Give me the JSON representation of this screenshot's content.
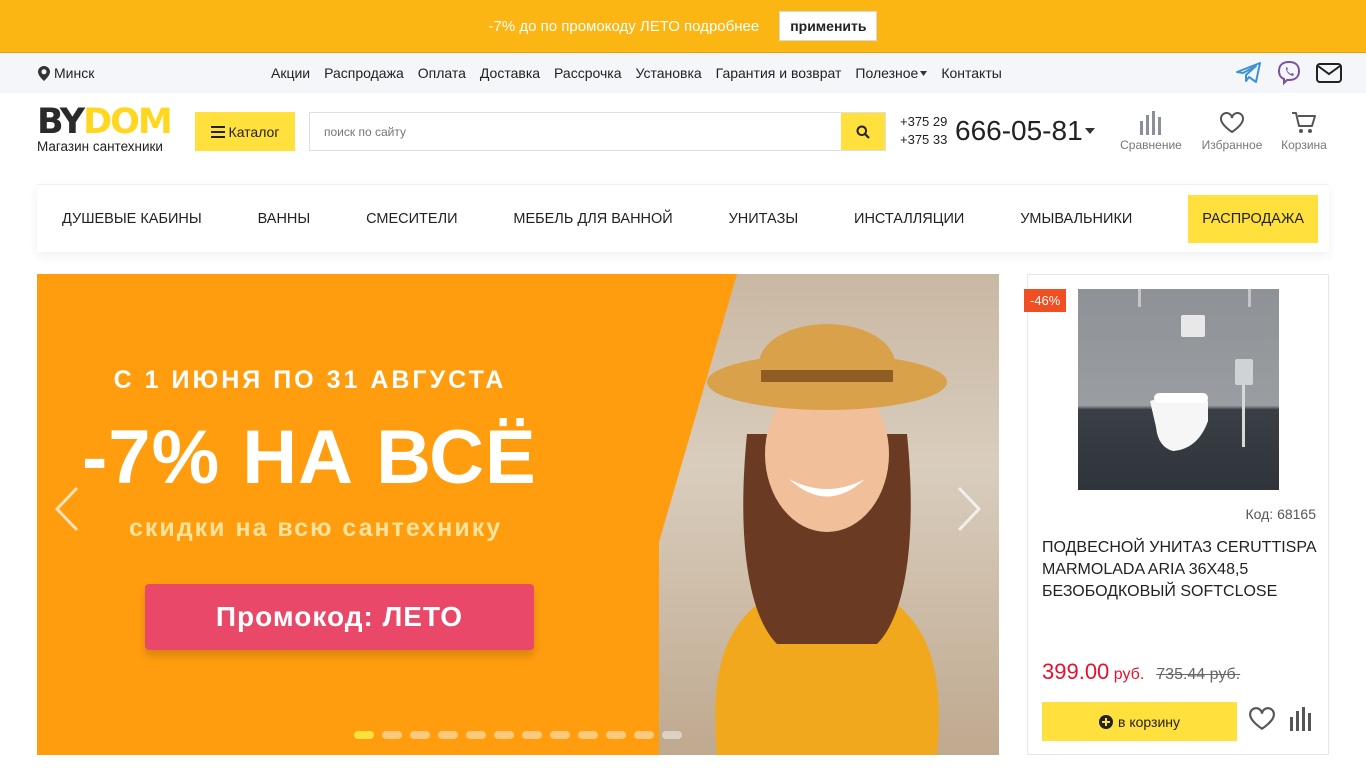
{
  "promo": {
    "text": "-7% до по промокоду ЛЕТО подробнее",
    "button": "применить"
  },
  "topnav": {
    "city": "Минск",
    "links": [
      "Акции",
      "Распродажа",
      "Оплата",
      "Доставка",
      "Рассрочка",
      "Установка",
      "Гарантия и возврат",
      "Полезное",
      "Контакты"
    ],
    "social": [
      "telegram-icon",
      "viber-icon",
      "email-icon"
    ]
  },
  "header": {
    "logo_main_1": "BY",
    "logo_main_2": "DOM",
    "logo_sub": "Магазин сантехники",
    "catalog": "Каталог",
    "search_placeholder": "поиск по сайту",
    "phone_code_1": "+375 29",
    "phone_code_2": "+375 33",
    "phone_number": "666-05-81",
    "compare": "Сравнение",
    "favorites": "Избранное",
    "cart": "Корзина"
  },
  "categories": [
    "ДУШЕВЫЕ КАБИНЫ",
    "ВАННЫ",
    "СМЕСИТЕЛИ",
    "МЕБЕЛЬ ДЛЯ ВАННОЙ",
    "УНИТАЗЫ",
    "ИНСТАЛЛЯЦИИ",
    "УМЫВАЛЬНИКИ",
    "РАСПРОДАЖА"
  ],
  "banner": {
    "line1": "С 1 ИЮНЯ ПО 31 АВГУСТА",
    "line2": "-7% НА ВСЁ",
    "line3": "скидки на всю сантехнику",
    "promo": "Промокод: ЛЕТО",
    "slide_count": 12,
    "active_slide": 1
  },
  "product": {
    "badge": "-46%",
    "code": "Код: 68165",
    "title": "ПОДВЕСНОЙ УНИТАЗ CERUTTISPA MARMOLADA ARIA 36X48,5 БЕЗОБОДКОВЫЙ SOFTCLOSE",
    "price": "399.00",
    "currency": "руб.",
    "old_price": "735.44 руб.",
    "cart_button": "в корзину"
  },
  "colors": {
    "accent": "#ffe03c",
    "promo_bar": "#fcb614",
    "price": "#e8112d",
    "badge": "#f04e23",
    "banner": "#ff9d0f",
    "banner_promo": "#e94868"
  }
}
